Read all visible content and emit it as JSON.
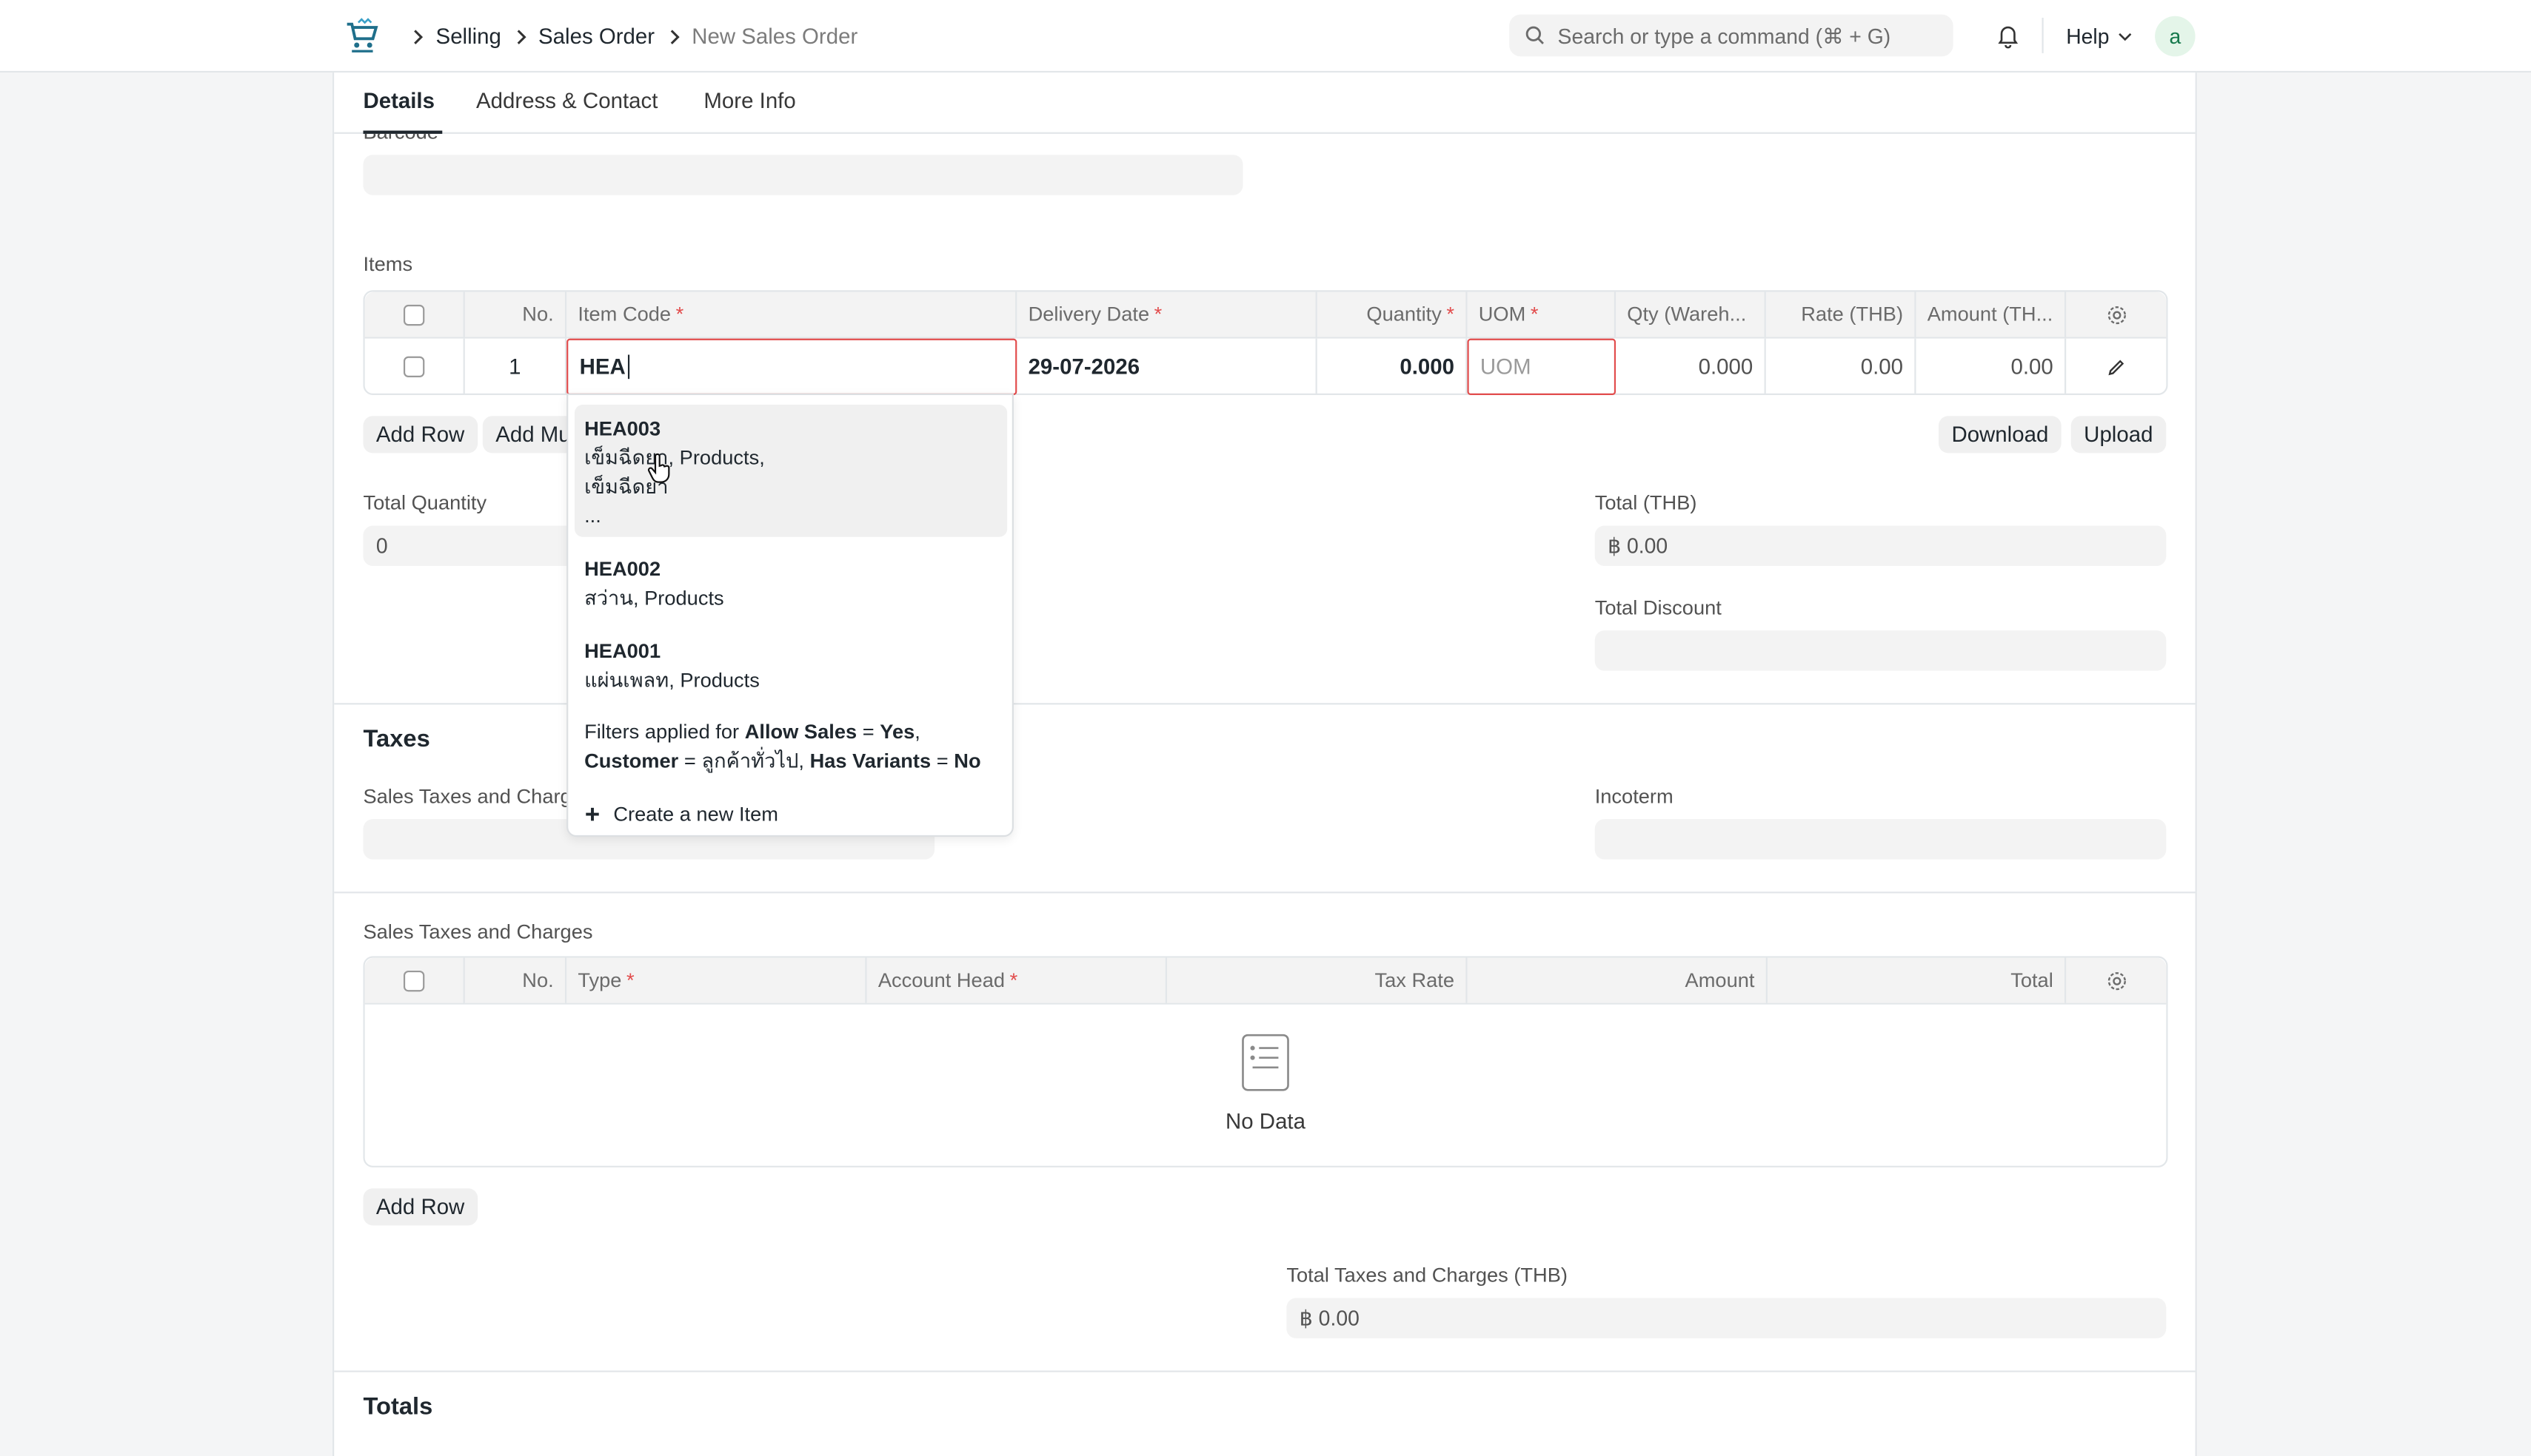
{
  "nav": {
    "breadcrumbs": [
      "Selling",
      "Sales Order",
      "New Sales Order"
    ],
    "search_placeholder": "Search or type a command (⌘ + G)",
    "help_label": "Help",
    "avatar_letter": "a"
  },
  "tabs": [
    "Details",
    "Address & Contact",
    "More Info"
  ],
  "barcode_label": "Barcode",
  "items": {
    "label": "Items",
    "columns": {
      "no": "No.",
      "item_code": "Item Code",
      "delivery_date": "Delivery Date",
      "quantity": "Quantity",
      "uom": "UOM",
      "qty_wareh": "Qty (Wareh...",
      "rate": "Rate (THB)",
      "amount": "Amount (TH..."
    },
    "row": {
      "no": "1",
      "item_code": "HEA",
      "delivery_date": "29-07-2026",
      "quantity": "0.000",
      "uom_placeholder": "UOM",
      "qty_wareh": "0.000",
      "rate": "0.00",
      "amount": "0.00"
    },
    "add_row": "Add Row",
    "add_multiple": "Add Mu",
    "download": "Download",
    "upload": "Upload"
  },
  "dropdown": {
    "results": [
      {
        "code": "HEA003",
        "line1": "เข็มฉีดยา, Products,",
        "line2": "เข็มฉีดยา",
        "line3": "..."
      },
      {
        "code": "HEA002",
        "line1": "สว่าน, Products"
      },
      {
        "code": "HEA001",
        "line1": "แผ่นเพลท, Products"
      }
    ],
    "filters_prefix": "Filters applied for",
    "filter1_key": "Allow Sales",
    "filter1_val": "Yes",
    "filter2_key": "Customer",
    "filter2_val": "ลูกค้าทั่วไป",
    "filter3_key": "Has Variants",
    "filter3_val": "No",
    "eq": "=",
    "create_label": "Create a new Item"
  },
  "totals_left": {
    "label": "Total Quantity",
    "value": "0"
  },
  "totals_right": {
    "total_label": "Total (THB)",
    "total_value": "฿ 0.00",
    "discount_label": "Total Discount"
  },
  "taxes": {
    "title": "Taxes",
    "template_label": "Sales Taxes and Charg",
    "incoterm_label": "Incoterm",
    "table_label": "Sales Taxes and Charges",
    "columns": {
      "no": "No.",
      "type": "Type",
      "account_head": "Account Head",
      "tax_rate": "Tax Rate",
      "amount": "Amount",
      "total": "Total"
    },
    "no_data": "No Data",
    "add_row": "Add Row",
    "total_taxes_label": "Total Taxes and Charges (THB)",
    "total_taxes_value": "฿ 0.00"
  },
  "totals_section_title": "Totals",
  "colors": {
    "error_border": "#e24c4c",
    "accent": "#1f272e",
    "avatar_bg": "#e4f5e9"
  }
}
